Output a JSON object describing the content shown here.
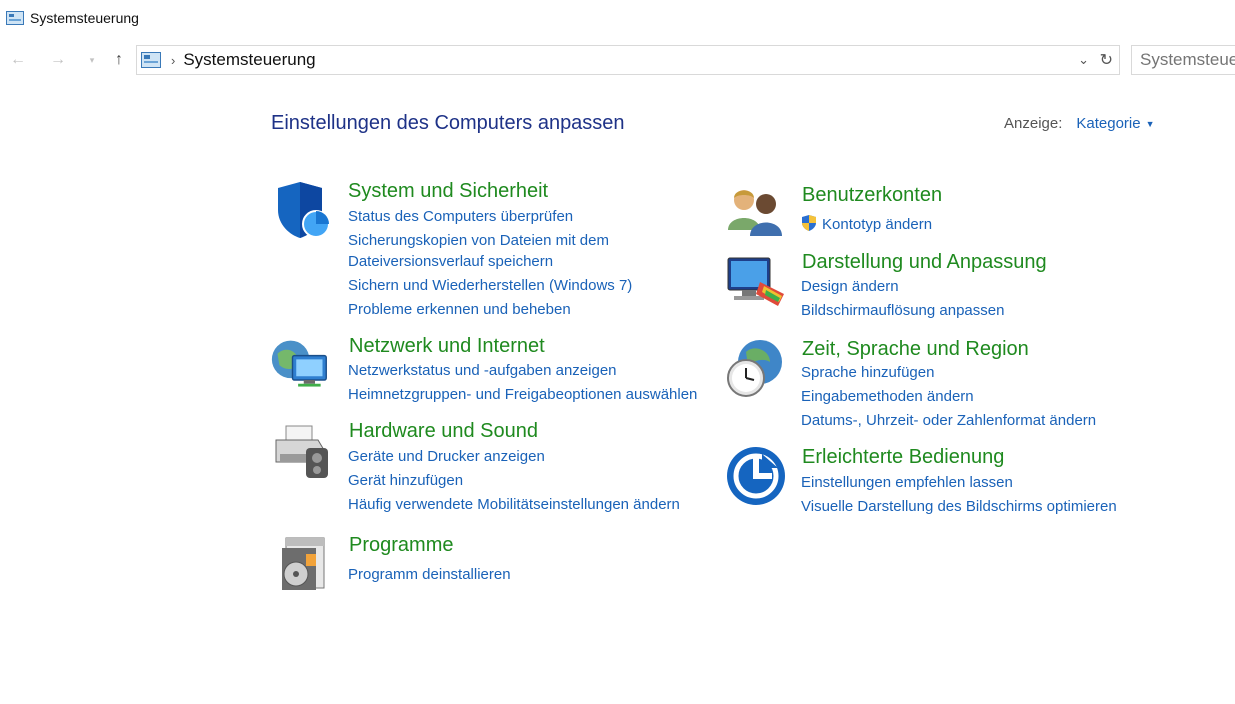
{
  "window": {
    "title": "Systemsteuerung"
  },
  "nav": {
    "back_icon": "back-arrow-icon",
    "forward_icon": "forward-arrow-icon",
    "up_icon": "up-arrow-icon",
    "breadcrumb": "Systemsteuerung",
    "search_placeholder": "Systemsteuerung durchsuchen"
  },
  "main": {
    "heading": "Einstellungen des Computers anpassen",
    "view_label": "Anzeige:",
    "view_value": "Kategorie"
  },
  "categories": {
    "system": {
      "icon": "shield-icon",
      "title": "System und Sicherheit",
      "links": [
        "Status des Computers überprüfen",
        "Sicherungskopien von Dateien mit dem",
        "Dateiversionsverlauf speichern",
        "Sichern und Wiederherstellen (Windows 7)",
        "Probleme erkennen und beheben"
      ]
    },
    "network": {
      "icon": "network-globe-icon",
      "title": "Netzwerk und Internet",
      "links": [
        "Netzwerkstatus und -aufgaben anzeigen",
        "Heimnetzgruppen- und Freigabeoptionen auswählen"
      ]
    },
    "hardware": {
      "icon": "printer-icon",
      "title": "Hardware und Sound",
      "links": [
        "Geräte und Drucker anzeigen",
        "Gerät hinzufügen",
        "Häufig verwendete Mobilitätseinstellungen ändern"
      ]
    },
    "programs": {
      "icon": "programs-icon",
      "title": "Programme",
      "links": [
        "Programm deinstallieren"
      ]
    },
    "accounts": {
      "icon": "users-icon",
      "title": "Benutzerkonten",
      "links": [
        "Kontotyp ändern"
      ]
    },
    "appearance": {
      "icon": "monitor-paint-icon",
      "title": "Darstellung und Anpassung",
      "links": [
        "Design ändern",
        "Bildschirmauflösung anpassen"
      ]
    },
    "region": {
      "icon": "clock-globe-icon",
      "title": "Zeit, Sprache und Region",
      "links": [
        "Sprache hinzufügen",
        "Eingabemethoden ändern",
        "Datums-, Uhrzeit- oder Zahlenformat ändern"
      ]
    },
    "access": {
      "icon": "ease-of-access-icon",
      "title": "Erleichterte Bedienung",
      "links": [
        "Einstellungen empfehlen lassen",
        "Visuelle Darstellung des Bildschirms optimieren"
      ]
    }
  },
  "colors": {
    "heading": "#1e3287",
    "category_title": "#1f8a1f",
    "link": "#1a62b8"
  }
}
